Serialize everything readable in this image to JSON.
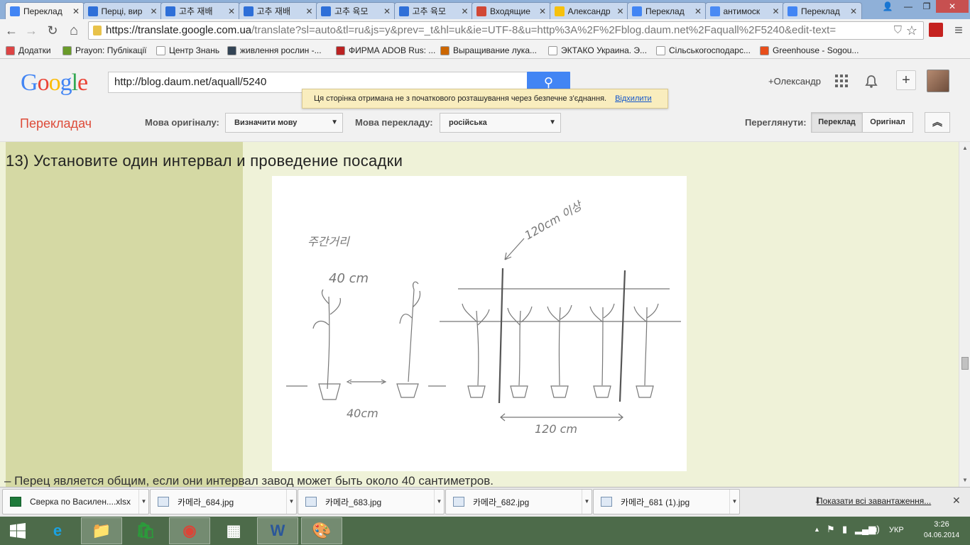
{
  "tabs": [
    {
      "title": "Переклад",
      "icon": "google-translate-icon",
      "color": "#4285f4",
      "active": true
    },
    {
      "title": "Перці, вир",
      "icon": "daum-blog-icon",
      "color": "#2e6fd8"
    },
    {
      "title": "고추 재배",
      "icon": "daum-blog-icon",
      "color": "#2e6fd8"
    },
    {
      "title": "고추 재배",
      "icon": "daum-blog-icon",
      "color": "#2e6fd8"
    },
    {
      "title": "고추 육모",
      "icon": "daum-blog-icon",
      "color": "#2e6fd8"
    },
    {
      "title": "고추 육모",
      "icon": "daum-blog-icon",
      "color": "#2e6fd8"
    },
    {
      "title": "Входящие",
      "icon": "gmail-icon",
      "color": "#d14836"
    },
    {
      "title": "Александр",
      "icon": "yandex-icon",
      "color": "#f6c10e"
    },
    {
      "title": "Переклад",
      "icon": "google-translate-icon",
      "color": "#4285f4"
    },
    {
      "title": "антимоск",
      "icon": "google-icon",
      "color": "#4a8af4"
    },
    {
      "title": "Переклад",
      "icon": "google-translate-icon",
      "color": "#4285f4"
    }
  ],
  "window_controls": {
    "user": "👤",
    "minimize": "—",
    "restore": "❐",
    "close": "✕"
  },
  "toolbar": {
    "back": "←",
    "forward": "→",
    "reload": "↻",
    "home": "⌂",
    "url_host": "https://translate.google.com.ua",
    "url_path": "/translate?sl=auto&tl=ru&js=y&prev=_t&hl=uk&ie=UTF-8&u=http%3A%2F%2Fblog.daum.net%2Faquall%2F5240&edit-text=",
    "star": "☆",
    "menu": "≡"
  },
  "bookmarks": [
    {
      "label": "Додатки",
      "icon": "apps-icon",
      "color": "#d44"
    },
    {
      "label": "Prayon: Публікації",
      "icon": "prayon-icon",
      "color": "#6a9b2a"
    },
    {
      "label": "Центр Знань",
      "icon": "page-icon",
      "color": "#fff"
    },
    {
      "label": "живлення рослин -...",
      "icon": "open-icon",
      "color": "#345"
    },
    {
      "label": "ФИРМА ADOB Rus: ...",
      "icon": "apple-icon",
      "color": "#b22"
    },
    {
      "label": "Выращивание лука...",
      "icon": "house-icon",
      "color": "#c60"
    },
    {
      "label": "ЭКТАКО Украина. Э...",
      "icon": "page-icon",
      "color": "#fff"
    },
    {
      "label": "Сільськогосподарс...",
      "icon": "page-icon",
      "color": "#fff"
    },
    {
      "label": "Greenhouse - Sogou...",
      "icon": "sogou-icon",
      "color": "#e84e1b"
    }
  ],
  "google_header": {
    "search_value": "http://blog.daum.net/aquall/5240",
    "search_button": "🔍",
    "user_name": "+Олександр",
    "apps": "⋮⋮⋮",
    "bell": "🔔",
    "plus": "+"
  },
  "notice": {
    "text": "Ця сторінка отримана не з початкового розташування через безпечне з'єднання.",
    "dismiss": "Відхилити"
  },
  "translate_bar": {
    "brand": "Перекладач",
    "source_label": "Мова оригіналу:",
    "source_value": "Визначити мову",
    "target_label": "Мова перекладу:",
    "target_value": "російська",
    "view_label": "Переглянути:",
    "view_translation": "Переклад",
    "view_original": "Оригінал",
    "collapse": "︽"
  },
  "content": {
    "heading": "13) Установите один интервал и проведение посадки",
    "sketch_labels": {
      "hangul_top": "주간거리",
      "left_dist": "40 cm",
      "between_dist": "40cm",
      "tall_label": "120cm 이상",
      "bottom_dist": "120 cm"
    },
    "bottom_text": "– Перец является общим, если они интервал завод может быть около 40 сантиметров."
  },
  "downloads": [
    {
      "name": "Сверка по Василен....xlsx",
      "icon": "excel-file-icon"
    },
    {
      "name": "카메라_684.jpg",
      "icon": "image-file-icon"
    },
    {
      "name": "카메라_683.jpg",
      "icon": "image-file-icon"
    },
    {
      "name": "카메라_682.jpg",
      "icon": "image-file-icon"
    },
    {
      "name": "카메라_681 (1).jpg",
      "icon": "image-file-icon"
    }
  ],
  "downloads_show_all": "Показати всі завантаження...",
  "taskbar": {
    "apps": [
      {
        "icon": "ie-icon",
        "glyph": "e"
      },
      {
        "icon": "file-explorer-icon",
        "glyph": "📁"
      },
      {
        "icon": "store-icon",
        "glyph": "🛍"
      },
      {
        "icon": "chrome-icon",
        "glyph": "◉"
      },
      {
        "icon": "apps-grid-icon",
        "glyph": "▦"
      },
      {
        "icon": "word-icon",
        "glyph": "W"
      },
      {
        "icon": "paint-icon",
        "glyph": "🎨"
      }
    ],
    "lang": "УКР",
    "time": "3:26",
    "date": "04.06.2014"
  }
}
